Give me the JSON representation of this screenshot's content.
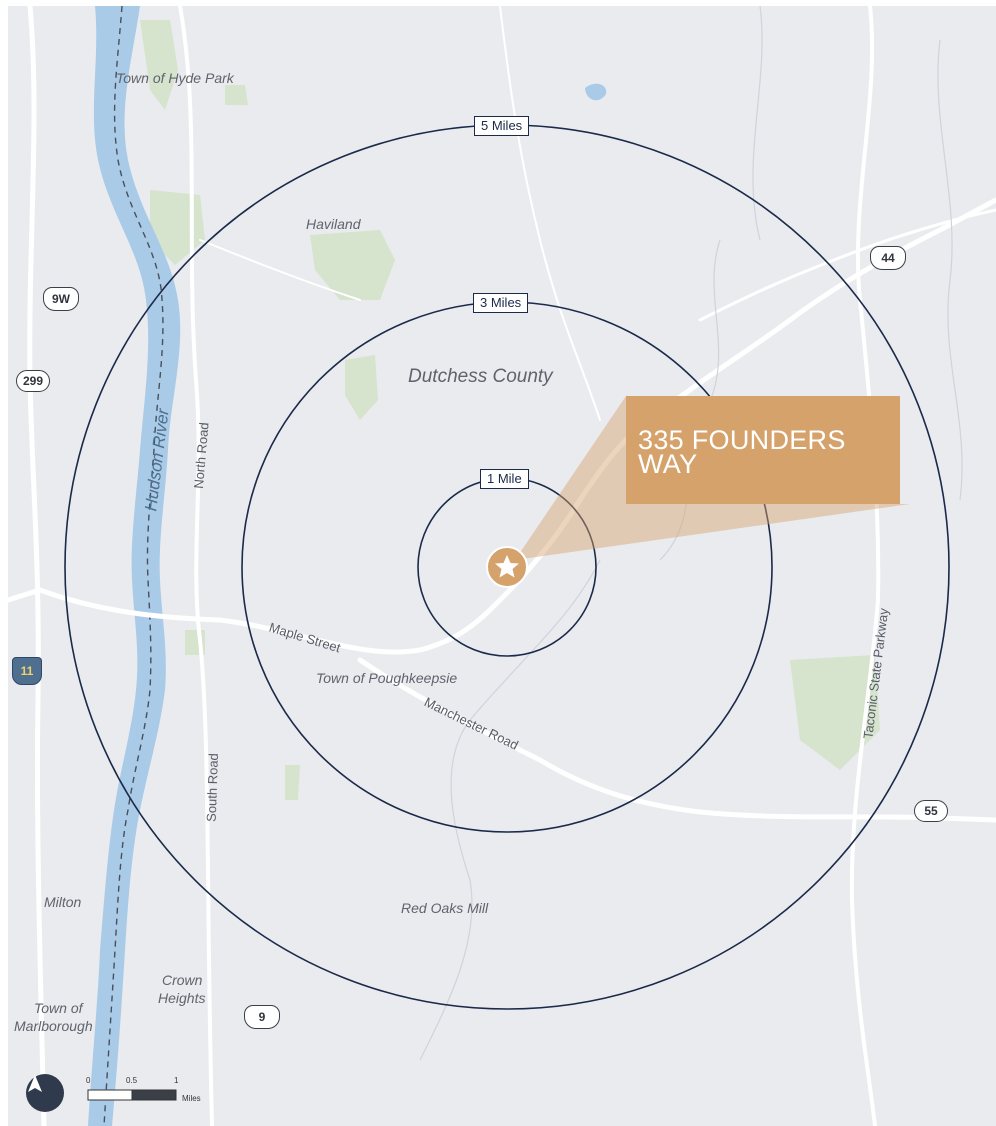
{
  "map": {
    "type": "radius-ring-map",
    "water_name": "Hudson River",
    "county": "Dutchess County",
    "rings": [
      {
        "label": "1 Mile",
        "radius_miles": 1
      },
      {
        "label": "3 Miles",
        "radius_miles": 3
      },
      {
        "label": "5 Miles",
        "radius_miles": 5
      }
    ],
    "site": {
      "label": "335 FOUNDERS WAY",
      "marker": "star-icon"
    },
    "places": {
      "hyde_park": "Town of Hyde Park",
      "haviland": "Haviland",
      "poughkeepsie": "Town of Poughkeepsie",
      "red_oaks_mill": "Red Oaks Mill",
      "milton": "Milton",
      "crown_heights_1": "Crown",
      "crown_heights_2": "Heights",
      "marlborough_1": "Town of",
      "marlborough_2": "Marlborough"
    },
    "roads": {
      "north_road": "North Road",
      "south_road": "South Road",
      "maple_street": "Maple Street",
      "manchester_road": "Manchester Road",
      "taconic": "Taconic State Parkway"
    },
    "shields": {
      "us9w": "9W",
      "r299": "299",
      "r11": "11",
      "us44": "44",
      "r55": "55",
      "us9": "9"
    },
    "scale": {
      "ticks": [
        "0",
        "0.5",
        "1"
      ],
      "unit": "Miles"
    },
    "colors": {
      "land": "#e9ebee",
      "water": "#a9cbe8",
      "park": "#d5e2cc",
      "ring": "#1b2a4a",
      "accent": "#d6a26c"
    }
  }
}
